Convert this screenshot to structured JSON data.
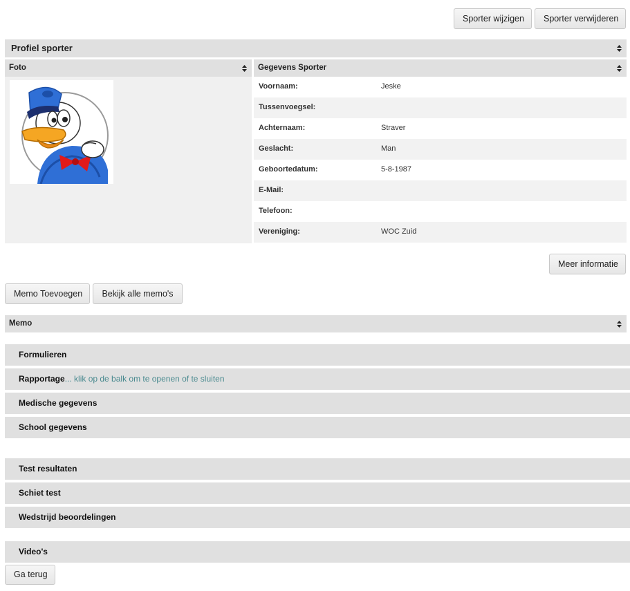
{
  "top_actions": {
    "edit_label": "Sporter wijzigen",
    "delete_label": "Sporter verwijderen"
  },
  "profile": {
    "title": "Profiel sporter",
    "foto_title": "Foto",
    "gegevens_title": "Gegevens Sporter",
    "fields": [
      {
        "label": "Voornaam:",
        "value": "Jeske"
      },
      {
        "label": "Tussenvoegsel:",
        "value": ""
      },
      {
        "label": "Achternaam:",
        "value": "Straver"
      },
      {
        "label": "Geslacht:",
        "value": "Man"
      },
      {
        "label": "Geboortedatum:",
        "value": "5-8-1987"
      },
      {
        "label": "E-Mail:",
        "value": ""
      },
      {
        "label": "Telefoon:",
        "value": ""
      },
      {
        "label": "Vereniging:",
        "value": "WOC Zuid"
      }
    ],
    "more_info_label": "Meer informatie"
  },
  "memo": {
    "add_label": "Memo Toevoegen",
    "view_all_label": "Bekijk alle memo's",
    "title": "Memo"
  },
  "sections": [
    {
      "label": "Formulieren",
      "hint": ""
    },
    {
      "label": "Rapportage",
      "hint": "... klik op de balk om te openen of te sluiten"
    },
    {
      "label": "Medische gegevens",
      "hint": ""
    },
    {
      "label": "School gegevens",
      "hint": ""
    },
    {
      "label": "Test resultaten",
      "hint": ""
    },
    {
      "label": "Schiet test",
      "hint": ""
    },
    {
      "label": "Wedstrijd beoordelingen",
      "hint": ""
    },
    {
      "label": "Video's",
      "hint": ""
    }
  ],
  "back_label": "Ga terug",
  "icons": {
    "sort": "sort-icon",
    "photo": "donald-duck-photo"
  }
}
